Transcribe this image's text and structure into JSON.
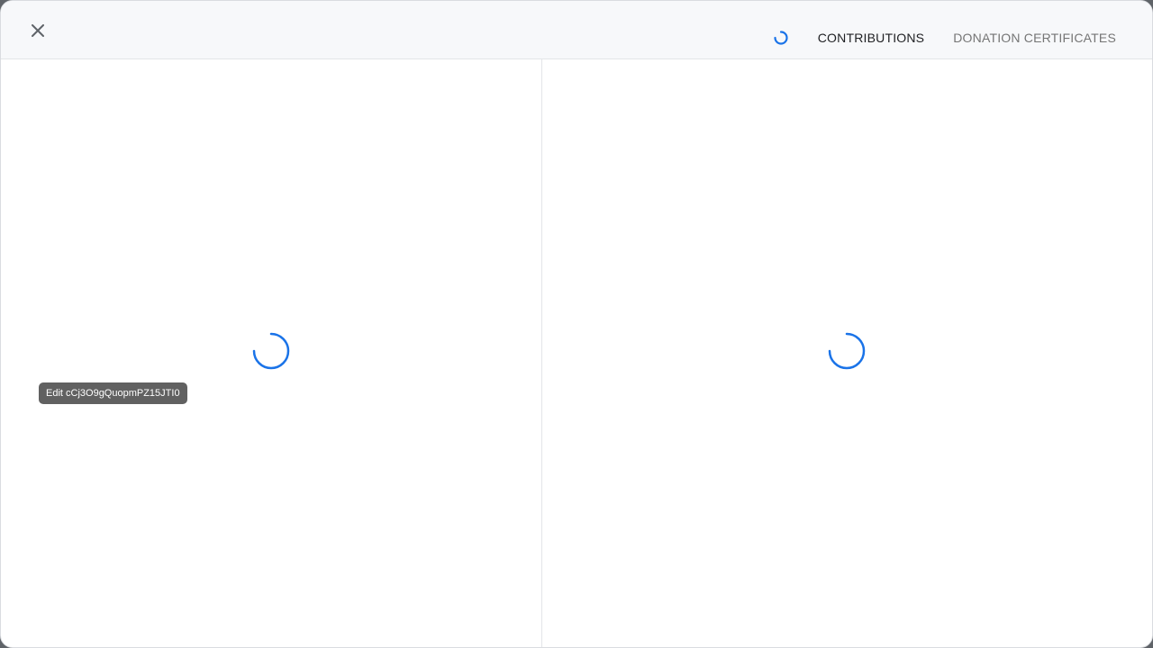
{
  "header": {
    "close_icon": "close-icon",
    "loading_icon": "loading-spinner-icon",
    "tabs": [
      {
        "label": "CONTRIBUTIONS",
        "active": true
      },
      {
        "label": "DONATION CERTIFICATES",
        "active": false
      }
    ]
  },
  "panes": {
    "left": {
      "state": "loading",
      "icon": "loading-spinner-icon"
    },
    "right": {
      "state": "loading",
      "icon": "loading-spinner-icon"
    }
  },
  "tooltip": {
    "text": "Edit cCj3O9gQuopmPZ15JTI0"
  },
  "colors": {
    "accent": "#1a73e8",
    "header_bg": "#f7f8fa",
    "tooltip_bg": "#616161",
    "tab_active": "#202124",
    "tab_inactive": "#757575"
  }
}
